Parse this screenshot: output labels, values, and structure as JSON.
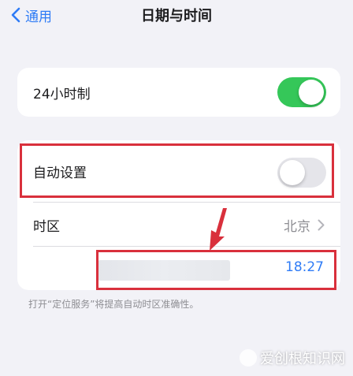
{
  "nav": {
    "back_label": "通用",
    "title": "日期与时间"
  },
  "settings": {
    "clock_24h": {
      "label": "24小时制",
      "enabled": true
    },
    "auto_set": {
      "label": "自动设置",
      "enabled": false
    },
    "timezone": {
      "label": "时区",
      "value": "北京"
    },
    "time": {
      "value": "18:27"
    }
  },
  "footnote": "打开“定位服务”将提高自动时区准确性。",
  "watermark": "爱创根知识网",
  "colors": {
    "accent": "#2f7cf6",
    "toggle_on": "#35c759",
    "annotation": "#d9303c"
  }
}
